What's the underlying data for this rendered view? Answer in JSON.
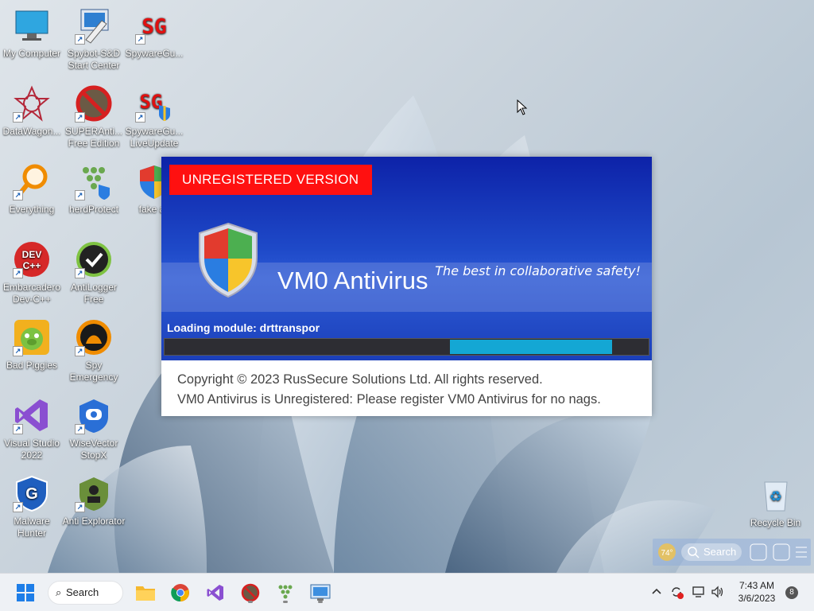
{
  "desktop": {
    "icons": [
      {
        "label": "My Computer",
        "icon": "monitor-icon"
      },
      {
        "label": "Spybot-S&D Start Center",
        "icon": "spybot-icon"
      },
      {
        "label": "SpywareGu...",
        "icon": "sg-icon"
      },
      {
        "label": "DataWagon...",
        "icon": "datawagon-icon"
      },
      {
        "label": "SUPERAnti... Free Edition",
        "icon": "superantispyware-icon"
      },
      {
        "label": "SpywareGu... LiveUpdate",
        "icon": "sg-liveupdate-icon"
      },
      {
        "label": "Everything",
        "icon": "magnifier-icon"
      },
      {
        "label": "herdProtect",
        "icon": "herdprotect-icon"
      },
      {
        "label": "fake av",
        "icon": "shield-icon"
      },
      {
        "label": "Embarcadero Dev-C++",
        "icon": "devcpp-icon"
      },
      {
        "label": "AntiLogger Free",
        "icon": "antilogger-icon"
      },
      {
        "label": "Bad Piggies",
        "icon": "bad-piggies-icon"
      },
      {
        "label": "Spy Emergency",
        "icon": "spy-emergency-icon"
      },
      {
        "label": "Visual Studio 2022",
        "icon": "visual-studio-icon"
      },
      {
        "label": "WiseVector StopX",
        "icon": "wisevector-icon"
      },
      {
        "label": "Malware Hunter",
        "icon": "malware-hunter-icon"
      },
      {
        "label": "Anti Explorator",
        "icon": "anti-explorator-icon"
      }
    ],
    "recycle_bin": "Recycle Bin"
  },
  "splash": {
    "badge": "UNREGISTERED VERSION",
    "product": "VM0 Antivirus",
    "tagline": "The best in collaborative safety!",
    "loading": "Loading module: drttranspor",
    "progress": {
      "indeterminate_segment_start": 0.59,
      "indeterminate_segment_end": 0.925
    },
    "copyright": "Copyright © 2023 RusSecure Solutions Ltd. All rights reserved.",
    "nag": "VM0 Antivirus is Unregistered: Please register VM0 Antivirus for no nags."
  },
  "widget": {
    "temp": "74°",
    "search_placeholder": "Search"
  },
  "taskbar": {
    "search_label": "Search",
    "time": "7:43 AM",
    "date": "3/6/2023",
    "notifications": "8"
  },
  "colors": {
    "accent_blue": "#1b3fb9",
    "badge_red": "#ff1010",
    "progress_cyan": "#14a7d4"
  }
}
